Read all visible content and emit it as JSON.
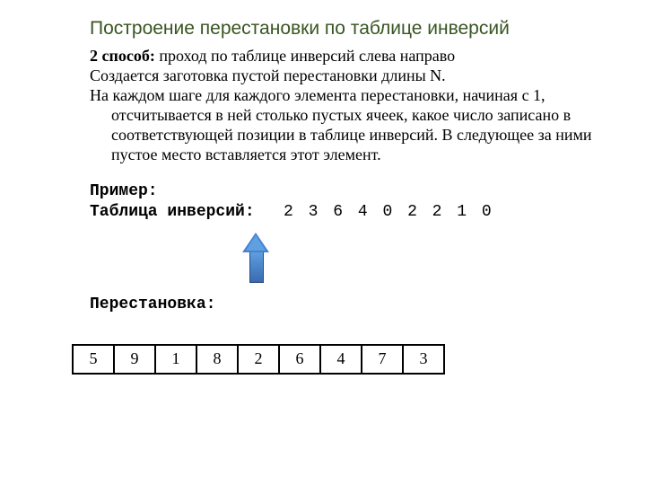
{
  "title": "Построение перестановки по таблице инверсий",
  "method_lead": "2 способ:",
  "method_tail": " проход по таблице инверсий слева направо",
  "para1": "Создается заготовка пустой перестановки длины N.",
  "para2": "На каждом шаге для каждого элемента перестановки, начиная с 1, отсчитывается в ней столько пустых ячеек, какое число записано в соответствующей позиции в таблице инверсий.  В следующее за ними пустое место вставляется этот элемент.",
  "example_label": "Пример:",
  "inv_label": "Таблица инверсий:",
  "inv_values": "2 3 6 4 0 2 2 1 0",
  "perm_label": "Перестановка:",
  "perm": [
    "5",
    "9",
    "1",
    "8",
    "2",
    "6",
    "4",
    "7",
    "3"
  ]
}
